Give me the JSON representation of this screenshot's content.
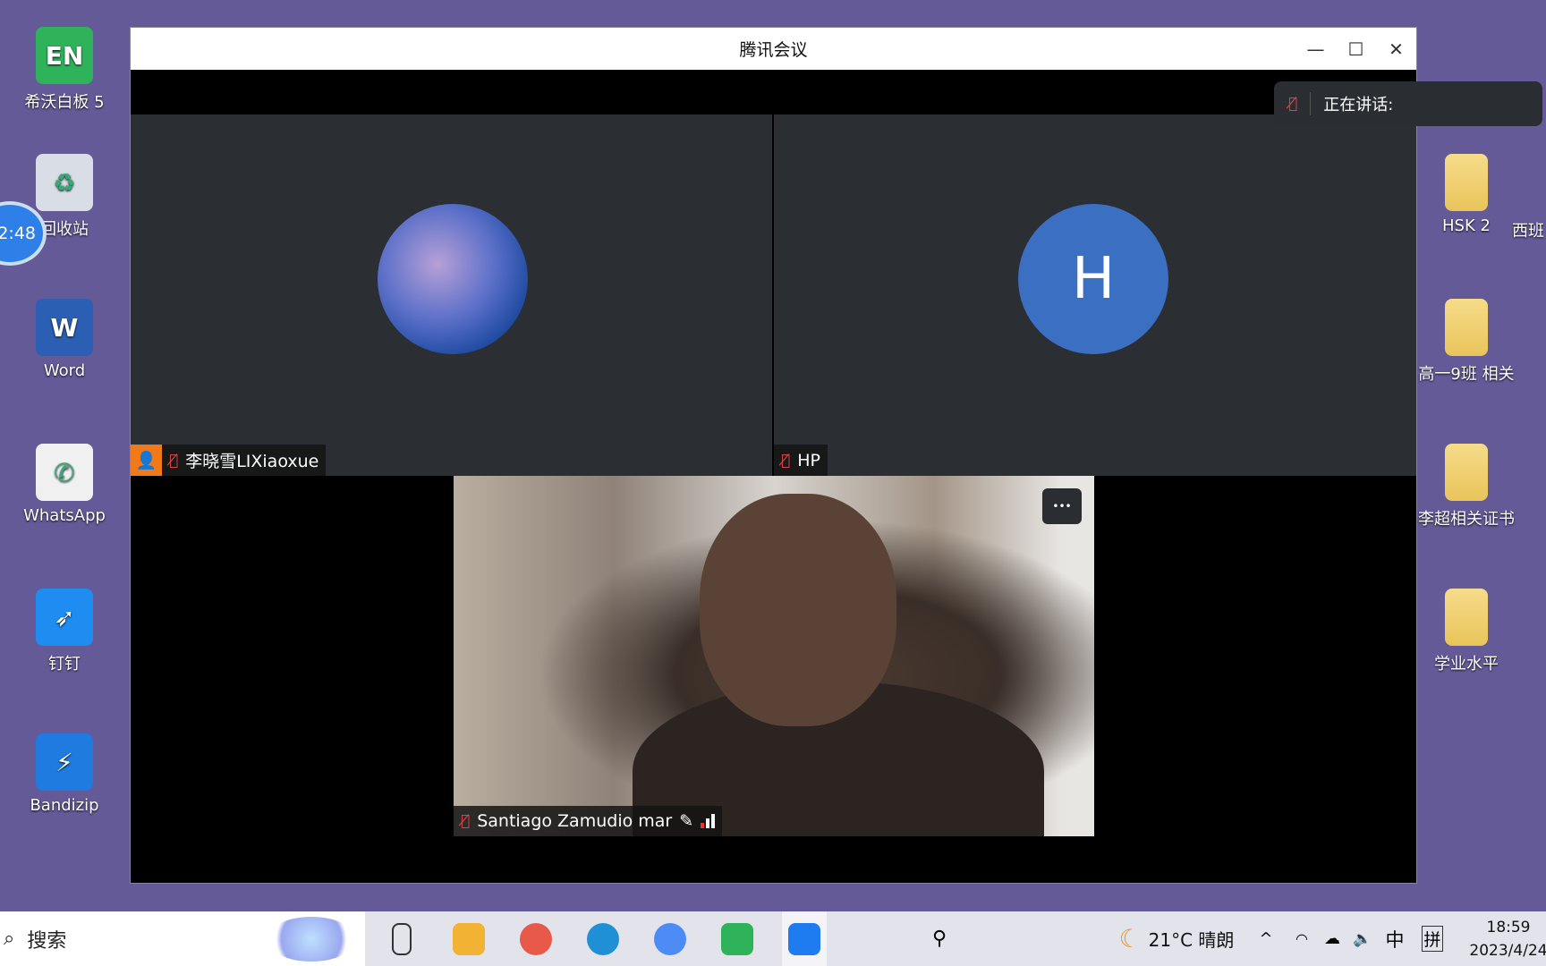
{
  "desktop": {
    "left_icons": [
      {
        "label": "希沃白板 5",
        "color": "#2fb35a",
        "glyph": "EN"
      },
      {
        "label": "回收站",
        "color": "#d8dde6",
        "glyph": "♻"
      },
      {
        "label": "Word",
        "color": "#2b5fb3",
        "glyph": "W"
      },
      {
        "label": "WhatsApp",
        "color": "#f0f0f0",
        "glyph": "✆"
      },
      {
        "label": "钉钉",
        "color": "#1e8cf0",
        "glyph": "➶"
      },
      {
        "label": "Bandizip",
        "color": "#1f7be0",
        "glyph": "⚡"
      }
    ],
    "right_icons": [
      {
        "label": "HSK 2"
      },
      {
        "label": "高一9班 相关"
      },
      {
        "label": "李超相关证书"
      },
      {
        "label": "学业水平"
      }
    ],
    "partial_right_label": "西班",
    "timer_badge": "2:48"
  },
  "window": {
    "title": "腾讯会议",
    "speaking_label": "正在讲话:",
    "participants": [
      {
        "name": "李晓雪LIXiaoxue",
        "muted": true,
        "host": true
      },
      {
        "name": "HP",
        "avatar_letter": "H",
        "avatar_color": "#3b6fc2",
        "muted": true
      },
      {
        "name": "Santiago Zamudio mar",
        "muted": true,
        "video": true
      }
    ],
    "more_label": "•••"
  },
  "taskbar": {
    "search_placeholder": "搜索",
    "weather": "21°C 晴朗",
    "ime_lang": "中",
    "ime_mode": "拼",
    "time": "18:59",
    "date": "2023/4/24",
    "apps": [
      "task-view",
      "file-explorer",
      "photos",
      "edge",
      "chrome",
      "easinote",
      "tencent-meeting"
    ]
  }
}
